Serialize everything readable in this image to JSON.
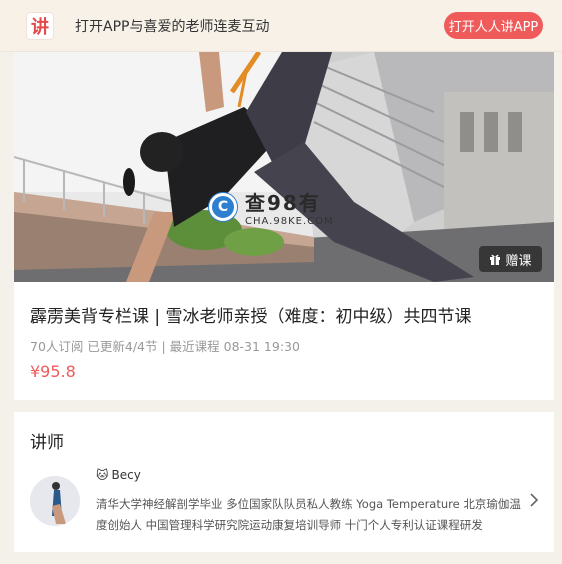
{
  "banner": {
    "logo_char": "讲",
    "text": "打开APP与喜爱的老师连麦互动",
    "open_app_label": "打开人人讲APP"
  },
  "course": {
    "gift_label": "赠课",
    "watermark": {
      "title": "查98有",
      "sub": "CHA.98KE.COM"
    },
    "title": "霹雳美背专栏课 | 雪冰老师亲授（难度：初中级）共四节课",
    "meta": "70人订阅   已更新4/4节 | 最近课程 08-31 19:30",
    "price": "¥95.8"
  },
  "teacher": {
    "section_title": "讲师",
    "name": "Becy",
    "desc": "清华大学神经解剖学毕业 多位国家队队员私人教练 Yoga Temperature 北京瑜伽温度创始人 中国管理科学研究院运动康复培训导师 十门个人专利认证课程研发"
  },
  "colors": {
    "accent": "#ef5b5b",
    "banner_bg": "#f7f1e8"
  },
  "icons": {
    "gift": "gift-icon",
    "chevron": "chevron-right-icon",
    "cat": "cat-emoji-icon"
  }
}
